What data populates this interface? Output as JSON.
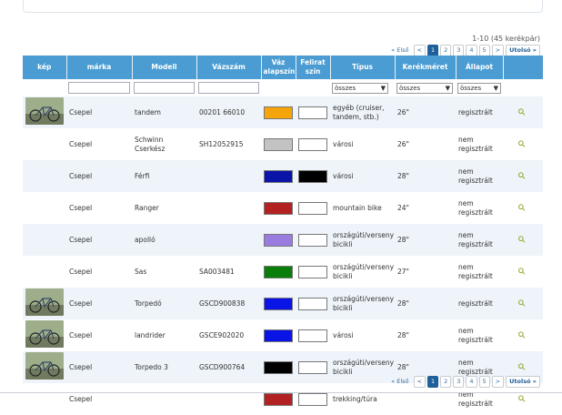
{
  "pagination": {
    "count_label": "1-10 (45 kerékpár)",
    "first": "« Első",
    "prev": "<",
    "pages": [
      "1",
      "2",
      "3",
      "4",
      "5"
    ],
    "current": "1",
    "next": ">",
    "last": "Utolsó »"
  },
  "columns": [
    "kép",
    "márka",
    "Modell",
    "Vázszám",
    "Váz alapszín",
    "Felirat szín",
    "Típus",
    "Kerékméret",
    "Állapot",
    ""
  ],
  "filters": {
    "tipus": "összes",
    "kerekmeret": "összes",
    "allapot": "összes"
  },
  "rows": [
    {
      "has_image": true,
      "brand": "Csepel",
      "model": "tandem",
      "frame": "00201 66010",
      "frame_color": "#f5a50a",
      "text_color": "#ffffff",
      "type": "egyéb (cruiser, tandem, stb.)",
      "wheel": "26\"",
      "status": "regisztrált"
    },
    {
      "has_image": false,
      "brand": "Csepel",
      "model": "Schwinn Cserkész",
      "frame": "SH12052915",
      "frame_color": "#c3c3c3",
      "text_color": "#ffffff",
      "type": "városi",
      "wheel": "26\"",
      "status": "nem regisztrált"
    },
    {
      "has_image": false,
      "brand": "Csepel",
      "model": "Férfi",
      "frame": "",
      "frame_color": "#0a14a8",
      "text_color": "#000000",
      "type": "városi",
      "wheel": "28\"",
      "status": "nem regisztrált"
    },
    {
      "has_image": false,
      "brand": "Csepel",
      "model": "Ranger",
      "frame": "",
      "frame_color": "#b32222",
      "text_color": "#ffffff",
      "type": "mountain bike",
      "wheel": "24\"",
      "status": "nem regisztrált"
    },
    {
      "has_image": false,
      "brand": "Csepel",
      "model": "apolló",
      "frame": "",
      "frame_color": "#9a7ce0",
      "text_color": "#ffffff",
      "type": "országúti/verseny bicikli",
      "wheel": "28\"",
      "status": "nem regisztrált"
    },
    {
      "has_image": false,
      "brand": "Csepel",
      "model": "Sas",
      "frame": "SA003481",
      "frame_color": "#0a7d0a",
      "text_color": "#ffffff",
      "type": "országúti/verseny bicikli",
      "wheel": "27\"",
      "status": "nem regisztrált"
    },
    {
      "has_image": true,
      "brand": "Csepel",
      "model": "Torpedó",
      "frame": "GSCD900838",
      "frame_color": "#0a14e6",
      "text_color": "#ffffff",
      "type": "országúti/verseny bicikli",
      "wheel": "28\"",
      "status": "regisztrált"
    },
    {
      "has_image": true,
      "brand": "Csepel",
      "model": "landrider",
      "frame": "GSCE902020",
      "frame_color": "#0a14e6",
      "text_color": "#ffffff",
      "type": "városi",
      "wheel": "28\"",
      "status": "nem regisztrált"
    },
    {
      "has_image": true,
      "brand": "Csepel",
      "model": "Torpedo 3",
      "frame": "GSCD900764",
      "frame_color": "#000000",
      "text_color": "#ffffff",
      "type": "országúti/verseny bicikli",
      "wheel": "28\"",
      "status": "nem regisztrált"
    },
    {
      "has_image": false,
      "brand": "Csepel",
      "model": "",
      "frame": "",
      "frame_color": "#b32222",
      "text_color": "#ffffff",
      "type": "trekking/túra",
      "wheel": "",
      "status": "nem regisztrált"
    }
  ],
  "icons": {
    "details": "magnifier-icon",
    "dropdown": "triangle-down-icon"
  }
}
